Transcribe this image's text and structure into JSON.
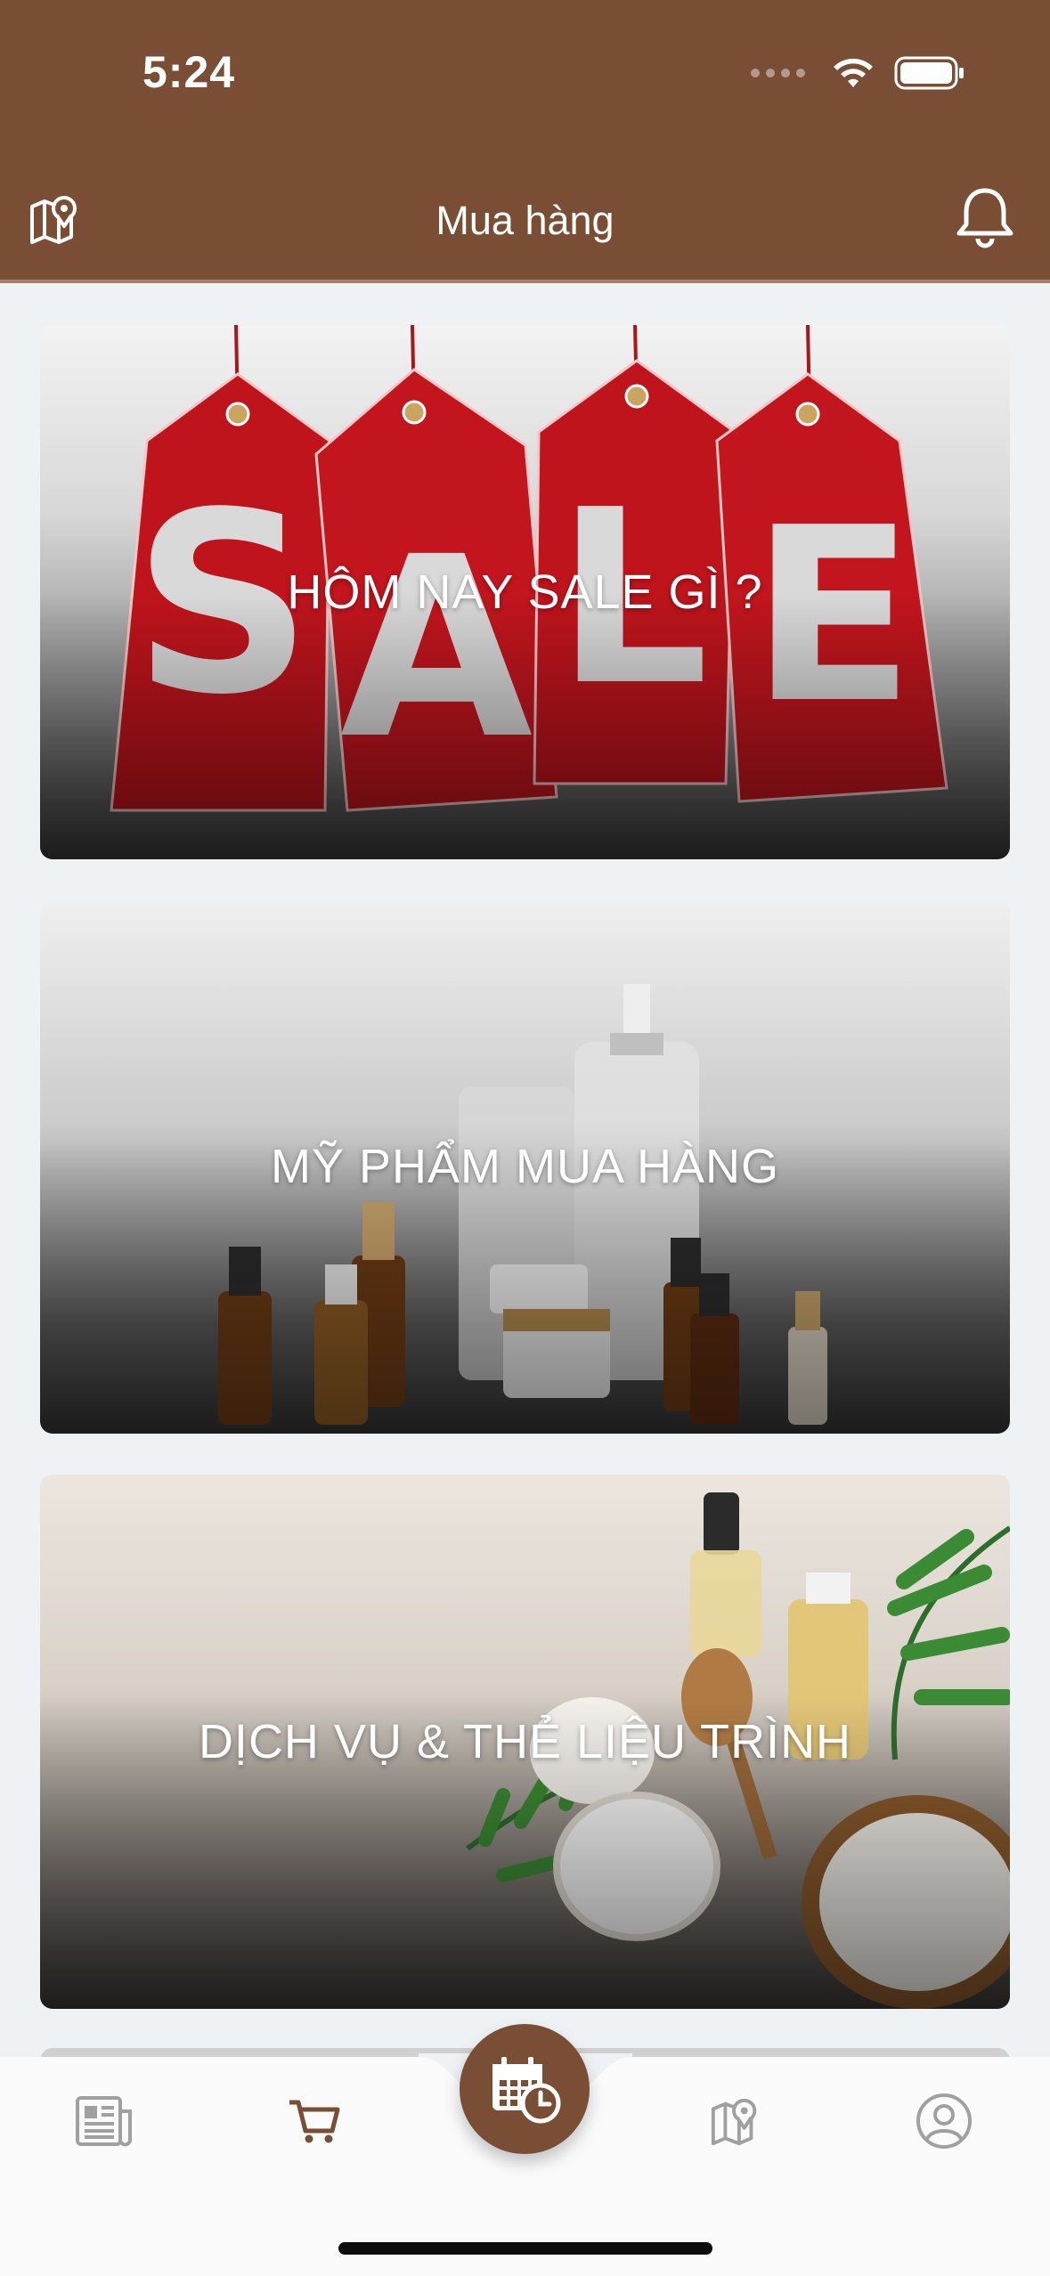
{
  "status_bar": {
    "time": "5:24"
  },
  "header": {
    "title": "Mua hàng",
    "left_icon": "map-pin-icon",
    "right_icon": "bell-icon",
    "background": "#7a4e34"
  },
  "cards": [
    {
      "label": "HÔM NAY SALE GÌ ?",
      "image": "sale-tags"
    },
    {
      "label": "MỸ PHẨM MUA HÀNG",
      "image": "cosmetic-bottles"
    },
    {
      "label": "DỊCH VỤ & THẺ LIỆU TRÌNH",
      "image": "spa-products"
    }
  ],
  "bottom_nav": {
    "items": [
      "news-icon",
      "cart-icon",
      "calendar-clock-icon",
      "map-icon",
      "profile-icon"
    ],
    "active": "cart-icon",
    "accent": "#7a4e34"
  }
}
